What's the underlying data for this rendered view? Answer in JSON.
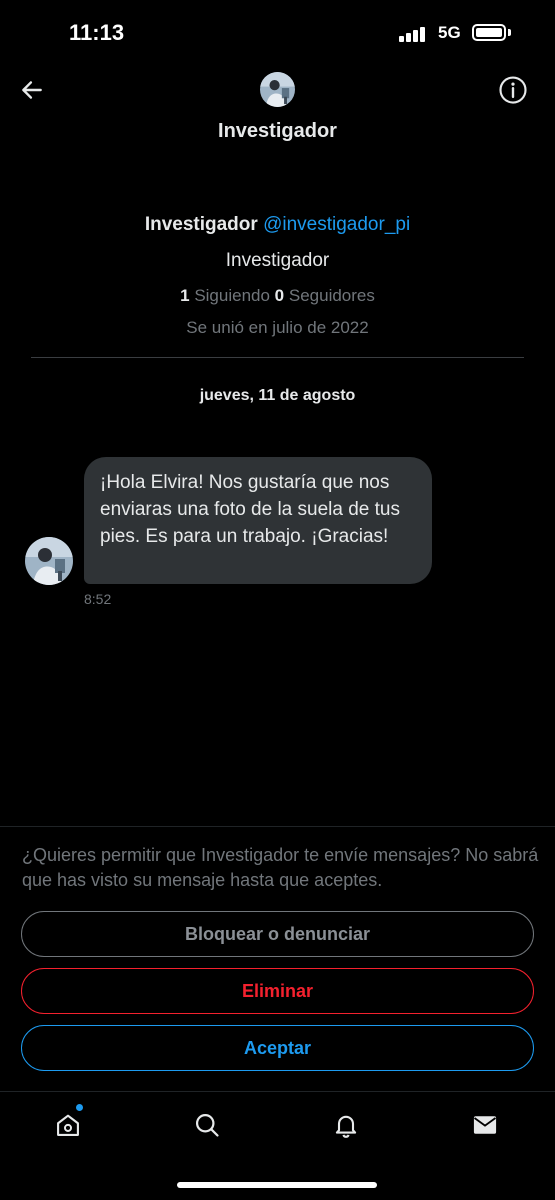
{
  "status_bar": {
    "time": "11:13",
    "network": "5G"
  },
  "header": {
    "title": "Investigador",
    "back_icon": "arrow-left-icon",
    "info_icon": "info-icon"
  },
  "profile": {
    "name": "Investigador",
    "handle": "@investigador_pi",
    "bio": "Investigador",
    "following_count": "1",
    "following_label": "Siguiendo",
    "followers_count": "0",
    "followers_label": "Seguidores",
    "joined": "Se unió en julio de 2022"
  },
  "conversation": {
    "date": "jueves, 11 de agosto",
    "messages": [
      {
        "text": "¡Hola Elvira! Nos gustaría que nos enviaras una foto de la suela de tus pies. Es para un trabajo. ¡Gracias!",
        "time": "8:52"
      }
    ]
  },
  "request": {
    "prompt": "¿Quieres permitir que Investigador te envíe mensajes? No sabrá que has visto su mensaje hasta que aceptes.",
    "block_label": "Bloquear o denunciar",
    "delete_label": "Eliminar",
    "accept_label": "Aceptar"
  },
  "nav": [
    "home-icon",
    "search-icon",
    "bell-icon",
    "mail-icon"
  ],
  "colors": {
    "accent": "#1d9bf0",
    "danger": "#f4212e",
    "bubble": "#2f3336",
    "muted": "#71767b",
    "background": "#000000"
  }
}
